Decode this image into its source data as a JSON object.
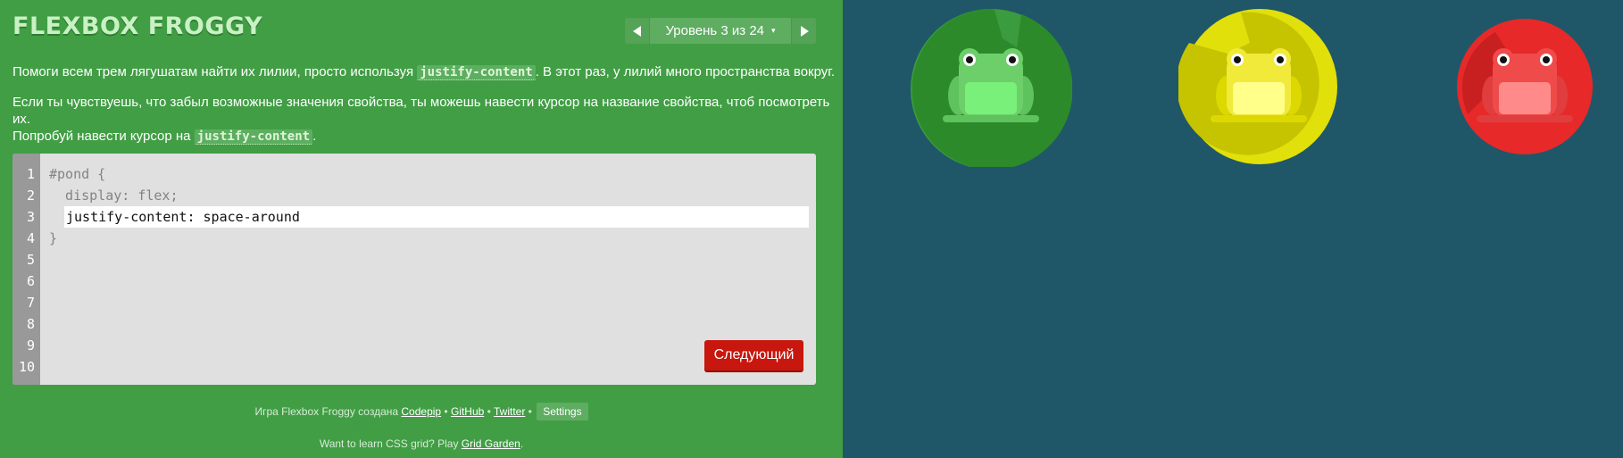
{
  "title": "FLEXBOX FROGGY",
  "level": {
    "label": "Уровень 3 из 24",
    "caret": "▾"
  },
  "instructions": {
    "p1_before": "Помоги всем трем лягушатам найти их лилии, просто используя ",
    "p1_code": "justify-content",
    "p1_after": ". В этот раз, у лилий много пространства вокруг.",
    "p2_line1": "Если ты чувствуешь, что забыл возможные значения свойства, ты можешь навести курсор на название свойства, чтоб посмотреть их.",
    "p2_before": "Попробуй навести курсор на ",
    "p2_code": "justify-content",
    "p2_after": "."
  },
  "editor": {
    "line_numbers": [
      "1",
      "2",
      "3",
      "4",
      "5",
      "6",
      "7",
      "8",
      "9",
      "10"
    ],
    "line1": "#pond {",
    "line2": "  display: flex;",
    "input_value": "justify-content: space-around",
    "line4": "}",
    "next_label": "Следующий"
  },
  "footer": {
    "credit_prefix": "Игра Flexbox Froggy создана ",
    "codepip": "Codepip",
    "sep": " • ",
    "github": "GitHub",
    "twitter": "Twitter",
    "settings": "Settings",
    "learn_prefix": "Want to learn CSS grid? Play ",
    "grid_garden": "Grid Garden",
    "learn_suffix": "."
  },
  "colors": {
    "left_panel": "#419e45",
    "pond": "#1f5768",
    "next_button": "#c8170e",
    "green_frog": "#6ccf6a",
    "yellow_frog": "#f1ea3b",
    "red_frog": "#ef4b4b"
  },
  "frogs": [
    {
      "color": "green",
      "icon": "green-frog-icon"
    },
    {
      "color": "yellow",
      "icon": "yellow-frog-icon"
    },
    {
      "color": "red",
      "icon": "red-frog-icon"
    }
  ]
}
